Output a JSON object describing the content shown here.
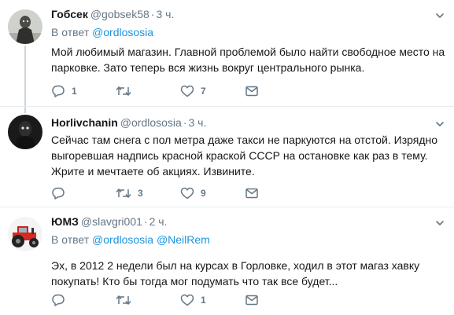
{
  "tweets": [
    {
      "name": "Гобсек",
      "handle": "@gobsek58",
      "time": "3 ч.",
      "reply_prefix": "В ответ",
      "reply_to": [
        "@ordlososia"
      ],
      "text": "Мой любимый магазин. Главной проблемой было найти свободное место на парковке. Зато теперь вся жизнь вокруг центрального рынка.",
      "counts": {
        "reply": "1",
        "retweet": "",
        "like": "7"
      }
    },
    {
      "name": "Horlivchanin",
      "handle": "@ordlososia",
      "time": "3 ч.",
      "reply_prefix": "",
      "reply_to": [],
      "text": "Сейчас там снега с пол метра даже такси не паркуются на отстой. Изрядно выгоревшая надпись красной краской СССР на остановке как раз в тему. Жрите и мечтаете об акциях. Извините.",
      "counts": {
        "reply": "",
        "retweet": "3",
        "like": "9"
      }
    },
    {
      "name": "ЮМЗ",
      "handle": "@slavgri001",
      "time": "2 ч.",
      "reply_prefix": "В ответ",
      "reply_to": [
        "@ordlososia",
        "@NeilRem"
      ],
      "text": "Эх, в 2012 2 недели был на курсах в Горловке, ходил в этот магаз хавку покупать! Кто бы тогда мог подумать что так все будет...",
      "counts": {
        "reply": "",
        "retweet": "",
        "like": "1"
      }
    }
  ],
  "name_display": [
    "Гобсек",
    "Horlivchanin",
    "ЮМЗ"
  ],
  "colors": {
    "link": "#1b95e0",
    "muted": "#657786",
    "separator": "#e6ecf0",
    "thread": "#ccd6dd"
  }
}
